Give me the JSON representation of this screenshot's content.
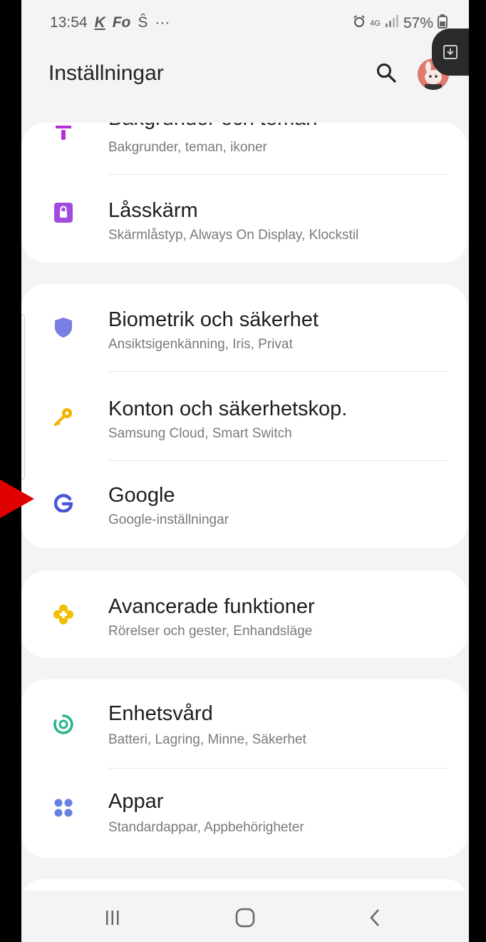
{
  "status": {
    "time": "13:54",
    "notif1": "K",
    "notif2": "Fo",
    "notif3": "Ŝ",
    "more": "···",
    "battery": "57%",
    "network": "4G"
  },
  "appbar": {
    "title": "Inställningar"
  },
  "cards": [
    {
      "rows": [
        {
          "title": "Bakgrunder och teman",
          "sub": "Bakgrunder, teman, ikoner",
          "icon": "brush-icon",
          "color": "#b430d6"
        },
        {
          "title": "Låsskärm",
          "sub": "Skärmlåstyp, Always On Display, Klockstil",
          "icon": "lock-icon",
          "color": "#a249e0"
        }
      ]
    },
    {
      "rows": [
        {
          "title": "Biometrik och säkerhet",
          "sub": "Ansiktsigenkänning, Iris, Privat",
          "icon": "shield-icon",
          "color": "#7a7fe4"
        },
        {
          "title": "Konton och säkerhetskop.",
          "sub": "Samsung Cloud, Smart Switch",
          "icon": "key-icon",
          "color": "#f1b300"
        },
        {
          "title": "Google",
          "sub": "Google-inställningar",
          "icon": "google-icon",
          "color": "#4a56d8"
        }
      ]
    },
    {
      "rows": [
        {
          "title": "Avancerade funktioner",
          "sub": "Rörelser och gester, Enhandsläge",
          "icon": "advanced-features-icon",
          "color": "#f0c000"
        }
      ]
    },
    {
      "rows": [
        {
          "title": "Enhetsvård",
          "sub": "Batteri, Lagring, Minne, Säkerhet",
          "icon": "device-care-icon",
          "color": "#27b38e"
        },
        {
          "title": "Appar",
          "sub": "Standardappar, Appbehörigheter",
          "icon": "apps-icon",
          "color": "#6a80e0"
        }
      ]
    }
  ],
  "annotation": {
    "arrow_color": "#e00000"
  }
}
